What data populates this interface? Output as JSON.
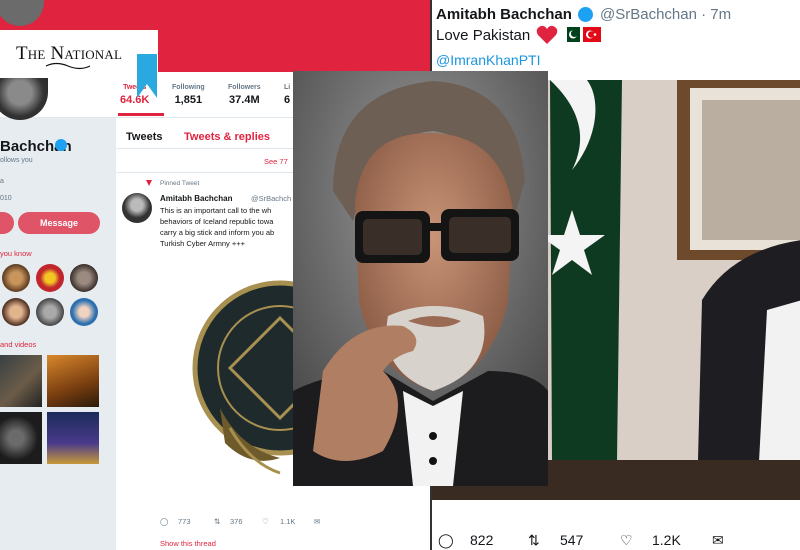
{
  "logo": {
    "text": "The National",
    "color": "#111111",
    "accent": "#2aa9e0"
  },
  "profile": {
    "stats": [
      {
        "label": "Tweets",
        "value": "64.6K"
      },
      {
        "label": "Following",
        "value": "1,851"
      },
      {
        "label": "Followers",
        "value": "37.4M"
      },
      {
        "label": "Li",
        "value": "6"
      }
    ],
    "name": "Bachchan",
    "follows_you": "ollows you",
    "meta_a": "a",
    "joined": "010",
    "message_button": "Message",
    "you_know_heading": "you know",
    "photos_heading": "and videos",
    "accent_color": "#e0243f"
  },
  "timeline": {
    "tabs": [
      "Tweets",
      "Tweets & replies"
    ],
    "see_new": "See 77",
    "pinned_label": "Pinned Tweet",
    "tweet": {
      "name": "Amitabh Bachchan",
      "handle": "@SrBachch",
      "lines": [
        "This is an important call to the wh",
        "behaviors of Iceland republic towa",
        "carry a big stick and inform you ab",
        "Turkish Cyber Armny +++"
      ],
      "actions": {
        "replies": "773",
        "retweets": "376",
        "likes": "1.1K"
      },
      "show_thread": "Show this thread"
    }
  },
  "right_tweet": {
    "name": "Amitabh Bachchan",
    "handle_time": "@SrBachchan · 7m",
    "text": "Love Pakistan",
    "mention": "@ImranKhanPTI",
    "icons": [
      "heart-icon",
      "pakistan-flag-icon",
      "turkey-flag-icon"
    ],
    "actions": {
      "replies": "822",
      "retweets": "547",
      "likes": "1.2K"
    }
  }
}
